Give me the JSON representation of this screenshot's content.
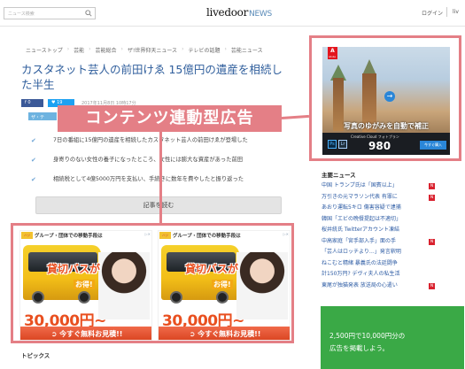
{
  "header": {
    "search_placeholder": "ニュース検索",
    "logo_main": "livedoor",
    "logo_sub": "NEWS",
    "login": "ログイン",
    "live": "liv"
  },
  "breadcrumb": [
    "ニューストップ",
    "芸能",
    "芸能総合",
    "ザ!世界仰天ニュース",
    "テレビの話題",
    "芸能ニュース"
  ],
  "article": {
    "title": "カスタネット芸人の前田けゑ 15億円の遺産を相続した半生",
    "share_fb": "0",
    "share_tw": "19",
    "date": "2017年11月8日 10時17分",
    "tag": "ザ・テ",
    "bullets": [
      "7日の番組に15億円の遺産を相続したカスタネット芸人の前田けゑが登場した",
      "身寄りのない女性の養子になったところ、女性には膨大な資産があった前田",
      "相続税として4億5000万円を支払い、手続きに数年を費やしたと振り返った"
    ],
    "more_button": "記事を読む"
  },
  "overlay": {
    "label": "コンテンツ連動型広告"
  },
  "left_ads": [
    {
      "tagline": "グループ・団体での移動手段は",
      "mark": "ハジ",
      "headline": "貸切バスが",
      "sub": "お得!",
      "price": "30,000円~",
      "cta": "今すぐ無料お見積!!"
    },
    {
      "tagline": "グループ・団体での移動手段は",
      "mark": "ハジ",
      "headline": "貸切バスが",
      "sub": "お得!",
      "price": "30,000円~",
      "cta": "今すぐ無料お見積!!"
    }
  ],
  "right_ad": {
    "brand": "Adobe",
    "caption": "写真のゆがみを自動で補正",
    "plan": "Creative Cloud フォトプラン",
    "price": "980",
    "ps": "Ps",
    "lr": "Lr",
    "buy": "今すぐ購入"
  },
  "topics": {
    "heading": "トピックス"
  },
  "main_news": {
    "heading": "主要ニュース",
    "items": [
      {
        "text": "中国 トランプ氏は「国賓以上」",
        "new": true
      },
      {
        "text": "万引きの元マラソン代表 有罪に",
        "new": true
      },
      {
        "text": "あおり運転5キロ 傷害容疑で逮捕",
        "new": false
      },
      {
        "text": "韓国「エビの晩餐提起は不適切」",
        "new": false
      },
      {
        "text": "桜井統氏 Twitterアカウント凍結",
        "new": false
      },
      {
        "text": "中高家庭「宮手部入手」面の手",
        "new": true
      },
      {
        "text": "「芸人はロッチより…」発言釈明",
        "new": false
      },
      {
        "text": "ねこむと精緒 暴義氏の法廷闘争",
        "new": false
      },
      {
        "text": "計150万円? デヴィ夫人の私生活",
        "new": false
      },
      {
        "text": "東尾が独猫発表 放送局の心遣い",
        "new": true
      }
    ],
    "new_label": "N"
  },
  "green_ad": {
    "line1": "2,500円で10,000円分の",
    "line2": "広告を掲載しよう。"
  },
  "colors": {
    "overlay": "#e47f86",
    "title": "#2f5e9c",
    "link": "#2b5aa3",
    "green_ad": "#3aa946"
  }
}
